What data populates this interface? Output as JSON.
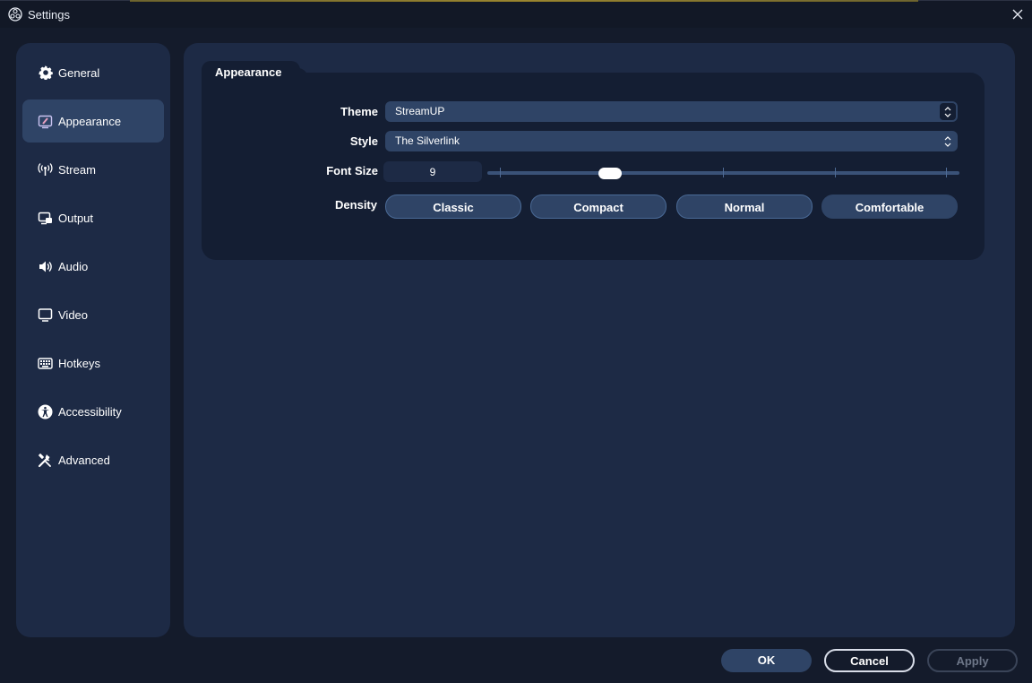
{
  "window": {
    "title": "Settings"
  },
  "sidebar": {
    "items": [
      {
        "label": "General",
        "icon": "gear-icon"
      },
      {
        "label": "Appearance",
        "icon": "appearance-icon",
        "active": true
      },
      {
        "label": "Stream",
        "icon": "antenna-icon"
      },
      {
        "label": "Output",
        "icon": "output-icon"
      },
      {
        "label": "Audio",
        "icon": "speaker-icon"
      },
      {
        "label": "Video",
        "icon": "monitor-icon"
      },
      {
        "label": "Hotkeys",
        "icon": "keyboard-icon"
      },
      {
        "label": "Accessibility",
        "icon": "accessibility-icon"
      },
      {
        "label": "Advanced",
        "icon": "tools-icon"
      }
    ]
  },
  "appearance": {
    "group_title": "Appearance",
    "theme": {
      "label": "Theme",
      "value": "StreamUP"
    },
    "style": {
      "label": "Style",
      "value": "The Silverlink"
    },
    "font_size": {
      "label": "Font Size",
      "value": "9",
      "slider_fraction": 0.26
    },
    "density": {
      "label": "Density",
      "options": [
        "Classic",
        "Compact",
        "Normal",
        "Comfortable"
      ],
      "selected": "Comfortable"
    }
  },
  "footer": {
    "ok_label": "OK",
    "cancel_label": "Cancel",
    "apply_label": "Apply"
  },
  "colors": {
    "background": "#141b2b",
    "panel": "#1d2a45",
    "group_box": "#141e33",
    "accent": "#2f4466",
    "text": "#ffffff"
  }
}
